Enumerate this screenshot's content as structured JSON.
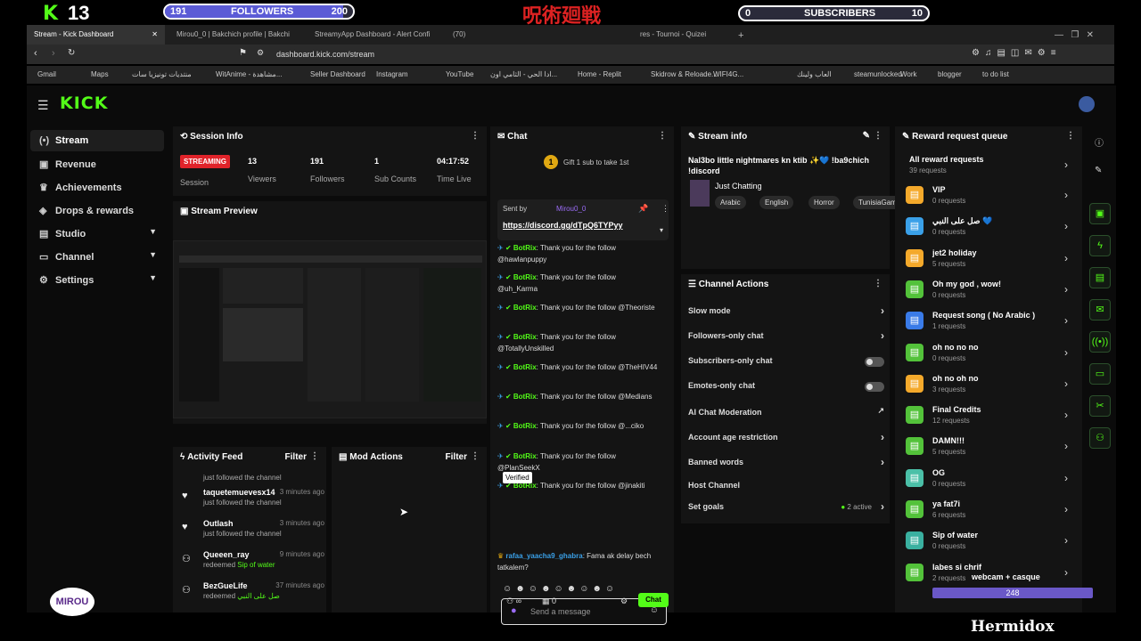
{
  "overlay": {
    "kick_count": "13",
    "followers_bar": {
      "start": "191",
      "label": "FOLLOWERS",
      "goal": "200",
      "progress": 0.95
    },
    "subscribers_bar": {
      "start": "0",
      "label": "SUBSCRIBERS",
      "goal": "10",
      "progress": 0.0
    },
    "bottom_label": "Hermidox",
    "webcam_label": "webcam + casque",
    "webcam_value": "248"
  },
  "browser": {
    "tabs": [
      {
        "label": "Stream - Kick Dashboard",
        "active": true
      },
      {
        "label": "Mirou0_0 | Bakchich profile | Bakchi",
        "active": false
      },
      {
        "label": "StreamyApp Dashboard - Alert Confi",
        "active": false
      },
      {
        "label": "(70)",
        "active": false
      },
      {
        "label": "res - Tournoi - Quizei",
        "active": false
      }
    ],
    "url": "dashboard.kick.com/stream",
    "bookmarks": [
      "Gmail",
      "Maps",
      "منتديات تونيزيا سات",
      "WitAnime - مشاهدة...",
      "Seller Dashboard",
      "Instagram",
      "YouTube",
      "ادا الحي - الثامي اون...",
      "Home - Replit",
      "Skidrow & Reloade...",
      "WIFI4G...",
      "العاب ولينك",
      "steamunlocked",
      "Work",
      "blogger",
      "to do list"
    ]
  },
  "sidebar": {
    "logo": "KICK",
    "items": [
      {
        "label": "Stream",
        "icon": "stream-icon",
        "active": true,
        "expandable": false
      },
      {
        "label": "Revenue",
        "icon": "revenue-icon",
        "active": false,
        "expandable": false
      },
      {
        "label": "Achievements",
        "icon": "trophy-icon",
        "active": false,
        "expandable": false
      },
      {
        "label": "Drops & rewards",
        "icon": "gift-icon",
        "active": false,
        "expandable": false
      },
      {
        "label": "Studio",
        "icon": "studio-icon",
        "active": false,
        "expandable": true
      },
      {
        "label": "Channel",
        "icon": "channel-icon",
        "active": false,
        "expandable": true
      },
      {
        "label": "Settings",
        "icon": "gear-icon",
        "active": false,
        "expandable": true
      }
    ]
  },
  "session": {
    "title": "Session Info",
    "status": "STREAMING",
    "status_label": "Session",
    "stats": [
      {
        "value": "13",
        "label": "Viewers"
      },
      {
        "value": "191",
        "label": "Followers"
      },
      {
        "value": "1",
        "label": "Sub Counts"
      },
      {
        "value": "04:17:52",
        "label": "Time Live"
      }
    ]
  },
  "preview": {
    "title": "Stream Preview"
  },
  "activity": {
    "title": "Activity Feed",
    "filter": "Filter",
    "top_line": "just followed the channel",
    "items": [
      {
        "user": "taquetemuevesx14",
        "time": "3 minutes ago",
        "desc": "just followed the channel",
        "highlight": "",
        "icon": "heart-icon"
      },
      {
        "user": "Outlash",
        "time": "3 minutes ago",
        "desc": "just followed the channel",
        "highlight": "",
        "icon": "heart-icon"
      },
      {
        "user": "Queeen_ray",
        "time": "9 minutes ago",
        "desc": "redeemed",
        "highlight": "Sip of water",
        "icon": "reward-icon"
      },
      {
        "user": "BezGueLife",
        "time": "37 minutes ago",
        "desc": "redeemed",
        "highlight": "صل على النبي",
        "icon": "reward-icon"
      }
    ]
  },
  "mod_actions": {
    "title": "Mod Actions",
    "filter": "Filter"
  },
  "chat": {
    "title": "Chat",
    "gift_text": "Gift 1 sub to take 1st",
    "gift_rank": "1",
    "pinned": {
      "sent_by": "Sent by",
      "user": "Mirou0_0",
      "link": "https://discord.gg/dTpQ6TYPyy"
    },
    "messages": [
      {
        "user": "BotRix",
        "text": "Thank you for the follow @hawlanpuppy"
      },
      {
        "user": "BotRix",
        "text": "Thank you for the follow @uh_Karma"
      },
      {
        "user": "BotRix",
        "text": "Thank you for the follow @Theoriste"
      },
      {
        "user": "BotRix",
        "text": "Thank you for the follow @TotallyUnskilled"
      },
      {
        "user": "BotRix",
        "text": "Thank you for the follow @TheHIV44"
      },
      {
        "user": "BotRix",
        "text": "Thank you for the follow @Medians"
      },
      {
        "user": "BotRix",
        "text": "Thank you for the follow @...ciko"
      },
      {
        "user": "BotRix",
        "text": "Thank you for the follow @PlanSeekX"
      },
      {
        "user": "BotRix",
        "text": "Thank you for the follow @jinakiti"
      }
    ],
    "last_user": "rafaa_yaacha9_ghabra",
    "last_text": "Fama ak delay bech tatkalem?",
    "tooltip": "Verified",
    "input_placeholder": "Send a message",
    "points": "0",
    "send_label": "Chat"
  },
  "stream_info": {
    "title": "Stream info",
    "stream_title": "Nal3bo little nightmares kn ktib ✨💙 !ba9chich !discord",
    "category": "Just Chatting",
    "tags": [
      "Arabic",
      "English",
      "Horror",
      "TunisiaGaming"
    ]
  },
  "channel_actions": {
    "title": "Channel Actions",
    "items": [
      {
        "label": "Slow mode",
        "control": "arrow"
      },
      {
        "label": "Followers-only chat",
        "control": "arrow"
      },
      {
        "label": "Subscribers-only chat",
        "control": "toggle"
      },
      {
        "label": "Emotes-only chat",
        "control": "toggle"
      },
      {
        "label": "AI Chat Moderation",
        "control": "external"
      },
      {
        "label": "Account age restriction",
        "control": "arrow"
      },
      {
        "label": "Banned words",
        "control": "arrow"
      },
      {
        "label": "Host Channel",
        "control": "none"
      },
      {
        "label": "Set goals",
        "control": "arrow",
        "badge": "2 active"
      }
    ]
  },
  "rewards": {
    "title": "Reward request queue",
    "all": {
      "label": "All reward requests",
      "count": "39 requests"
    },
    "items": [
      {
        "label": "VIP",
        "count": "0 requests",
        "color": "#f4a92b"
      },
      {
        "label": "صل على النبي 💙",
        "count": "0 requests",
        "color": "#3aa0e8"
      },
      {
        "label": "jet2 holiday",
        "count": "5 requests",
        "color": "#f4a92b"
      },
      {
        "label": "Oh my god , wow!",
        "count": "0 requests",
        "color": "#53c23a"
      },
      {
        "label": "Request song ( No Arabic )",
        "count": "1 requests",
        "color": "#3a7be8"
      },
      {
        "label": "oh no no no",
        "count": "0 requests",
        "color": "#53c23a"
      },
      {
        "label": "oh no oh no",
        "count": "3 requests",
        "color": "#f4a92b"
      },
      {
        "label": "Final Credits",
        "count": "12 requests",
        "color": "#53c23a"
      },
      {
        "label": "DAMN!!!",
        "count": "5 requests",
        "color": "#53c23a"
      },
      {
        "label": "OG",
        "count": "0 requests",
        "color": "#4bc0a8"
      },
      {
        "label": "ya fat7i",
        "count": "6 requests",
        "color": "#53c23a"
      },
      {
        "label": "Sip of water",
        "count": "0 requests",
        "color": "#3ab0a0"
      },
      {
        "label": "labes si chrif",
        "count": "2 requests",
        "color": "#53c23a"
      }
    ]
  }
}
